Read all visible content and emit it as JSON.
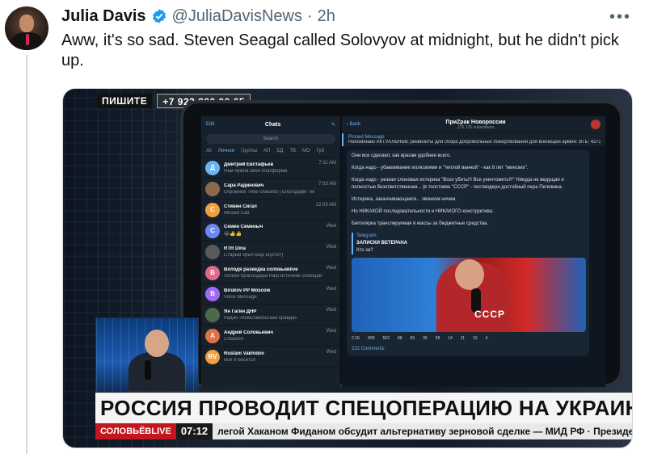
{
  "tweet": {
    "author_name": "Julia Davis",
    "handle": "@JuliaDavisNews",
    "separator": "·",
    "time": "2h",
    "more": "•••",
    "text": "Aww, it's so sad. Steven Seagal called Solovyov at midnight, but he didn't pick up."
  },
  "media": {
    "phone_label": "ПИШИТЕ",
    "phone_number": "+7 922 800 00 65",
    "banner": "РОССИЯ ПРОВОДИТ СПЕЦОПЕРАЦИЮ НА УКРАИНЕ",
    "ticker_logo": "СОЛОВЬЁВLIVE",
    "ticker_time": "07:12",
    "ticker_text": "легой Хаканом Фиданом обсудит альтернативу зерновой сделке — МИД РФ · Президент Габо",
    "tablet": {
      "chats_title": "Chats",
      "edit": "Edit",
      "search": "Search",
      "filters": [
        "All",
        "Личное",
        "Группы",
        "АП",
        "БД",
        "ТВ",
        "МО",
        "Губ"
      ],
      "rows": [
        {
          "initial": "Д",
          "name": "Дмитрий Евстафьев",
          "preview": "Нам нужна своя платформа",
          "time": "7:11 AM",
          "color": "#6ab2f2"
        },
        {
          "initial": "",
          "name": "Сара Радинович",
          "preview": "Огромное Тебе спасибо | Благодарю Тебя !",
          "time": "7:03 AM",
          "color": "#8a6a4a"
        },
        {
          "initial": "С",
          "name": "Стивен Сигал",
          "preview": "Missed Call",
          "time": "12:03 AM",
          "color": "#f0a040"
        },
        {
          "initial": "С",
          "name": "Семен Семеныч",
          "preview": "😂👍👍",
          "time": "Wed",
          "color": "#6a8af2"
        },
        {
          "initial": "",
          "name": "RTR Dina",
          "preview": "Старый хрыч еще шустит)",
          "time": "Wed",
          "color": "#5a5a5a"
        },
        {
          "initial": "В",
          "name": "Володя разведка соловьевlive",
          "preview": "Успехи Краснодара Наш источник сообщает",
          "time": "Wed",
          "color": "#e06a8a"
        },
        {
          "initial": "B",
          "name": "Birukov PP Moscow",
          "preview": "Voice Message",
          "time": "Wed",
          "color": "#a06af2"
        },
        {
          "initial": "",
          "name": "Ян Гагин ДНР",
          "preview": "Радио «Комсомольская правда»",
          "time": "Wed",
          "color": "#4a6a4a"
        },
        {
          "initial": "А",
          "name": "Андрей Соловьевич",
          "preview": "Спасибо",
          "time": "Wed",
          "color": "#e0704a"
        },
        {
          "initial": "RV",
          "name": "Rustam Vakhidov",
          "preview": "Всё и бесится",
          "time": "Wed",
          "color": "#f0a040"
        }
      ],
      "channel_back": "Back",
      "channel_name": "ПриZрак Новороссии",
      "channel_subs": "176 126 subscribers",
      "pinned_label": "Pinned Message",
      "pinned_text": "Напоминаю АКТУАЛЬНЫЕ реквизиты для сбора добровольных пожертвований для воюющей армии: ВТБ: 427229...",
      "messages": [
        "Они все сделают, как врагам удобнее всего.",
        "Когда надо - убаюкивание иллюзиями и \"теплой ванной\" - как 8 лет \"минских\".",
        "Когда надо - резкая слоновая истерика \"Всех убить!!! Все уничтожить!!!\" Никуда не ведущая и полностью безответственная... (в толстовке \"СССР\" - постмодерн достойный пера Пелевина.",
        "Истерика, заканчивающаяся... звонком ничем.",
        "Но НИКАКОЙ последовательности и НИКАКОГО конструктива.",
        "Биполярка транслируемая в массы за бюджетные средства."
      ],
      "forward_from": "Telegram",
      "forward_title": "ЗАПИСКИ ВЕТЕРАНА",
      "forward_text": "Кто за?",
      "video_text": "СССР",
      "reactions": [
        "2.1K",
        "865",
        "562",
        "88",
        "65",
        "36",
        "28",
        "14",
        "11",
        "10",
        "4"
      ],
      "comments": "222 Comments"
    }
  },
  "colors": {
    "link": "#1d9bf0",
    "muted": "#536471",
    "telegram_bg": "#0e1621",
    "banner_red": "#c4161c"
  }
}
